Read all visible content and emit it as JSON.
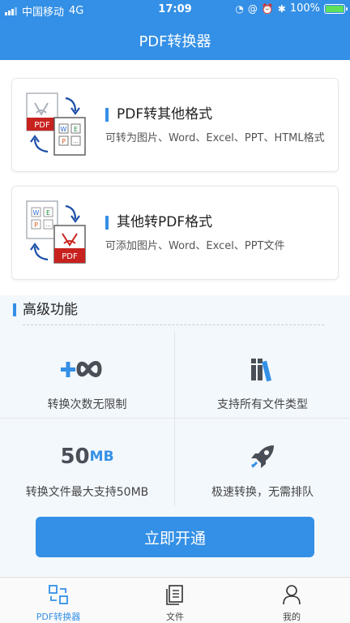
{
  "status_bar": {
    "carrier": "中国移动",
    "network": "4G",
    "time": "17:09",
    "battery_percent": "100%",
    "battery_level": 1.0
  },
  "nav": {
    "title": "PDF转换器"
  },
  "cards": [
    {
      "title": "PDF转其他格式",
      "desc": "可转为图片、Word、Excel、PPT、HTML格式"
    },
    {
      "title": "其他转PDF格式",
      "desc": "可添加图片、Word、Excel、PPT文件"
    }
  ],
  "illus": {
    "pdf_text": "PDF",
    "tiles": [
      "W",
      "E",
      "P",
      "..."
    ]
  },
  "advanced": {
    "title": "高级功能",
    "features": [
      {
        "label": "转换次数无限制",
        "icon": "plus-infinity-icon"
      },
      {
        "label": "支持所有文件类型",
        "icon": "books-icon"
      },
      {
        "label": "转换文件最大支持50MB",
        "icon": "size-50mb-icon",
        "value": "50",
        "unit": "MB"
      },
      {
        "label": "极速转换，无需排队",
        "icon": "rocket-icon"
      }
    ]
  },
  "cta": {
    "label": "立即开通"
  },
  "tabs": [
    {
      "label": "PDF转换器",
      "icon": "converter-icon",
      "active": true
    },
    {
      "label": "文件",
      "icon": "document-icon",
      "active": false
    },
    {
      "label": "我的",
      "icon": "user-icon",
      "active": false
    }
  ],
  "colors": {
    "primary": "#3490e6",
    "pdf_red": "#c8221f",
    "battery": "#5ee05a"
  }
}
